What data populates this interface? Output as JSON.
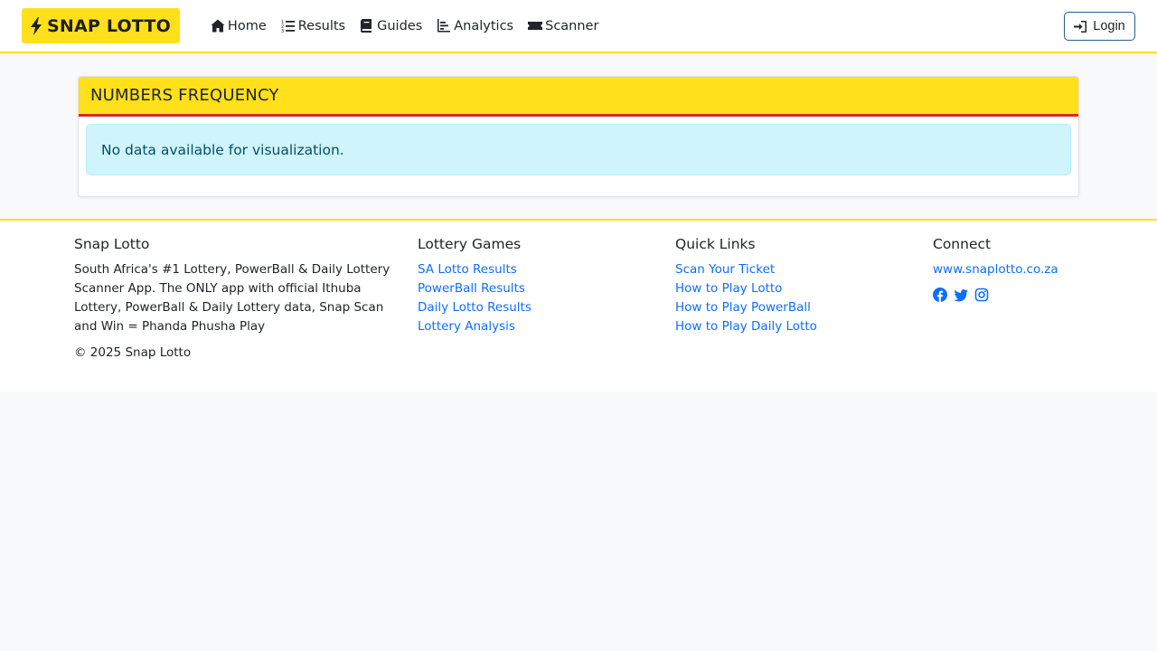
{
  "nav": {
    "brand": "SNAP LOTTO",
    "items": [
      {
        "label": "Home",
        "icon": "home-icon"
      },
      {
        "label": "Results",
        "icon": "list-ol-icon"
      },
      {
        "label": "Guides",
        "icon": "book-icon"
      },
      {
        "label": "Analytics",
        "icon": "chart-icon"
      },
      {
        "label": "Scanner",
        "icon": "ticket-icon"
      }
    ],
    "login": "Login"
  },
  "card": {
    "title": "NUMBERS FREQUENCY",
    "alert": "No data available for visualization."
  },
  "footer": {
    "about": {
      "title": "Snap Lotto",
      "text": "South Africa's #1 Lottery, PowerBall & Daily Lottery Scanner App. The ONLY app with official Ithuba Lottery, PowerBall & Daily Lottery data, Snap Scan and Win = Phanda Phusha Play",
      "copyright": "© 2025 Snap Lotto"
    },
    "games": {
      "title": "Lottery Games",
      "links": [
        "SA Lotto Results",
        "PowerBall Results",
        "Daily Lotto Results",
        "Lottery Analysis"
      ]
    },
    "quick": {
      "title": "Quick Links",
      "links": [
        "Scan Your Ticket",
        "How to Play Lotto",
        "How to Play PowerBall",
        "How to Play Daily Lotto"
      ]
    },
    "connect": {
      "title": "Connect",
      "website": "www.snaplotto.co.za",
      "social": [
        "facebook-icon",
        "twitter-icon",
        "instagram-icon"
      ]
    }
  },
  "colors": {
    "brand_yellow": "#ffe01b",
    "header_red": "#d62828",
    "link_blue": "#0d6efd",
    "alert_bg": "#cff4fc",
    "alert_text": "#055160"
  }
}
